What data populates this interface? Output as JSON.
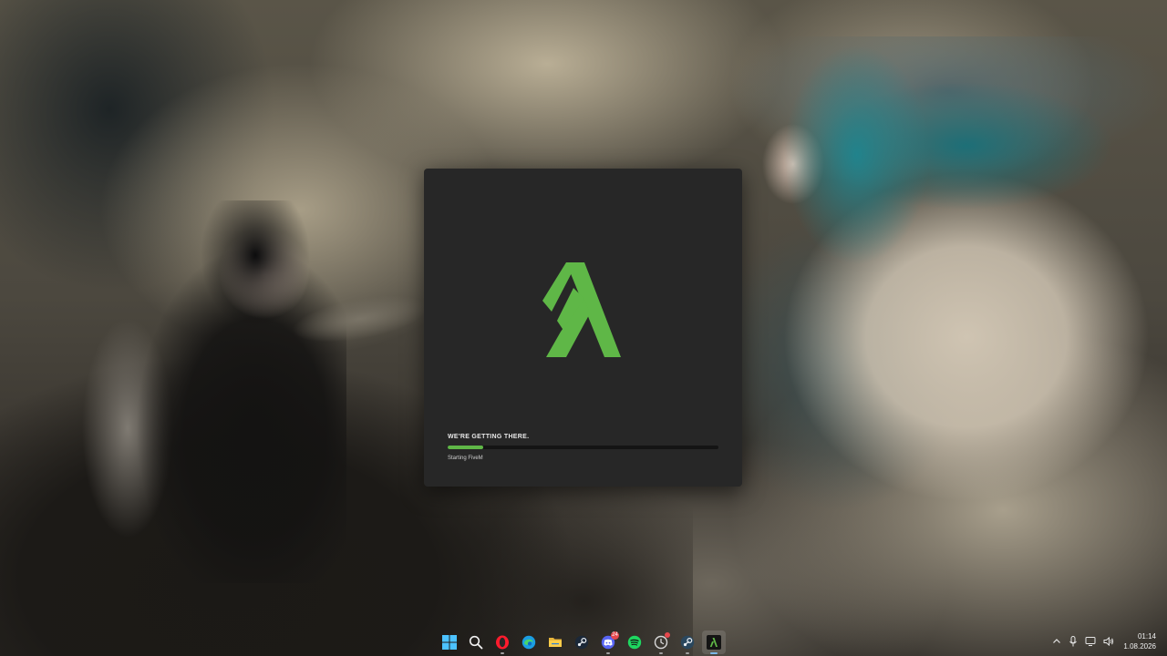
{
  "launcher": {
    "status_title": "WE'RE GETTING THERE.",
    "status_sub": "Starting FiveM",
    "progress": 0.13,
    "brand_color": "#5fb747"
  },
  "taskbar": {
    "apps": [
      {
        "name": "start-button",
        "icon": "windows-icon"
      },
      {
        "name": "search-button",
        "icon": "search-icon"
      },
      {
        "name": "opera-gx-button",
        "icon": "opera-icon"
      },
      {
        "name": "edge-button",
        "icon": "edge-icon"
      },
      {
        "name": "file-explorer-button",
        "icon": "folder-icon"
      },
      {
        "name": "steam-button",
        "icon": "steam-icon"
      },
      {
        "name": "discord-button",
        "icon": "discord-icon",
        "badge": "24"
      },
      {
        "name": "spotify-button",
        "icon": "spotify-icon"
      },
      {
        "name": "app-update-button",
        "icon": "circle-app-icon"
      },
      {
        "name": "steam-2-button",
        "icon": "steam-icon"
      },
      {
        "name": "fivem-button",
        "icon": "fivem-icon"
      }
    ],
    "tray_icons": [
      "chevron-up-icon",
      "microphone-icon",
      "display-icon",
      "speaker-icon"
    ],
    "clock": {
      "time": "01:14",
      "date": "1.08.2026"
    }
  }
}
